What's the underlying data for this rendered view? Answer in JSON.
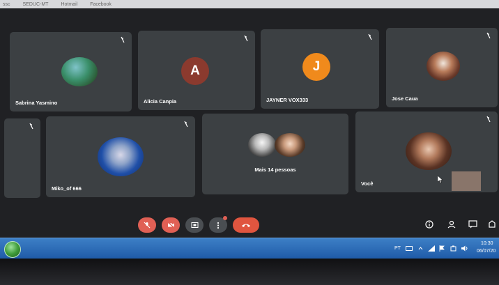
{
  "browser": {
    "tabs": [
      "ssc",
      "SEDUC-MT",
      "Hotmail",
      "Facebook"
    ]
  },
  "participants": [
    {
      "name": "Sabrina Yasmino",
      "avatar": "photo",
      "muted": true
    },
    {
      "name": "Alicia Canpia",
      "avatar": "letter",
      "initial": "A",
      "color": "#8b3a2e",
      "muted": true
    },
    {
      "name": "JAYNER VOX333",
      "avatar": "letter",
      "initial": "J",
      "color": "#f08a1c",
      "muted": true
    },
    {
      "name": "Jose Caua",
      "avatar": "photo",
      "muted": true
    },
    {
      "name": "",
      "avatar": "none",
      "muted": true
    },
    {
      "name": "Miko_of 666",
      "avatar": "photo",
      "muted": true
    },
    {
      "name": "Mais 14 pessoas",
      "avatar": "group",
      "muted": false
    },
    {
      "name": "Você",
      "avatar": "photo",
      "muted": true
    }
  ],
  "controls": {
    "buttons": [
      "mic-off-icon",
      "camera-off-icon",
      "present-screen-icon",
      "more-options-icon",
      "hang-up-icon"
    ],
    "colors": {
      "red": "#e06055",
      "gray": "#4a4e52",
      "hangup": "#e0553f"
    }
  },
  "right_controls": [
    "info-icon",
    "people-icon",
    "chat-icon",
    "activities-icon"
  ],
  "taskbar": {
    "lang": "PT",
    "time": "10:30",
    "date": "06/07/20"
  }
}
